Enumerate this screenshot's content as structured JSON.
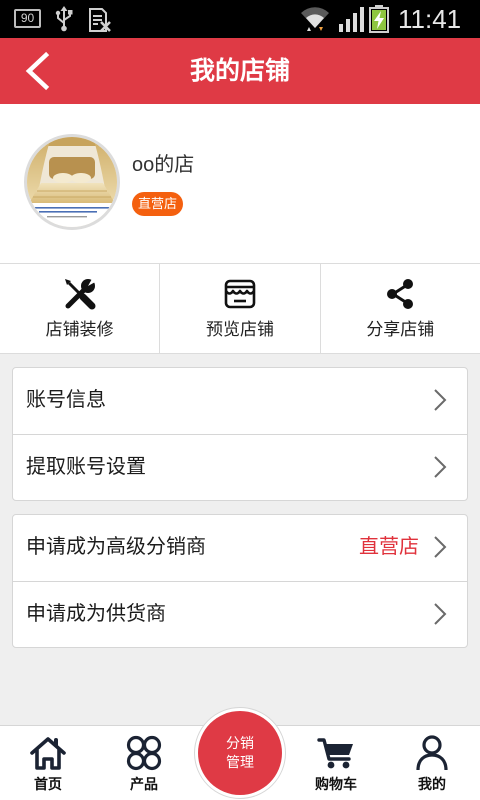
{
  "status_bar": {
    "notification_badge": "90",
    "time": "11:41",
    "icons": [
      "usb-icon",
      "sim-document-icon",
      "wifi-icon",
      "signal-icon",
      "battery-charging-icon"
    ]
  },
  "header": {
    "title": "我的店铺",
    "back_icon": "chevron-left-icon"
  },
  "shop": {
    "name": "oo的店",
    "badge": "直营店"
  },
  "actions": [
    {
      "label": "店铺装修",
      "icon": "tools-icon"
    },
    {
      "label": "预览店铺",
      "icon": "storefront-icon"
    },
    {
      "label": "分享店铺",
      "icon": "share-icon"
    }
  ],
  "menu_groups": [
    {
      "items": [
        {
          "label": "账号信息"
        },
        {
          "label": "提取账号设置"
        }
      ]
    },
    {
      "items": [
        {
          "label": "申请成为高级分销商",
          "value": "直营店"
        },
        {
          "label": "申请成为供货商"
        }
      ]
    }
  ],
  "bottom_nav": {
    "items": [
      {
        "label": "首页",
        "icon": "home-icon"
      },
      {
        "label": "产品",
        "icon": "grid-circles-icon"
      },
      {
        "label": "购物车",
        "icon": "cart-icon"
      },
      {
        "label": "我的",
        "icon": "person-icon"
      }
    ],
    "center_button": {
      "line1": "分销",
      "line2": "管理"
    }
  },
  "colors": {
    "primary": "#df3a45",
    "badge": "#f4600f",
    "value_text": "#e0323c",
    "page_background": "#efefef",
    "nav_icon": "#1b2333"
  }
}
